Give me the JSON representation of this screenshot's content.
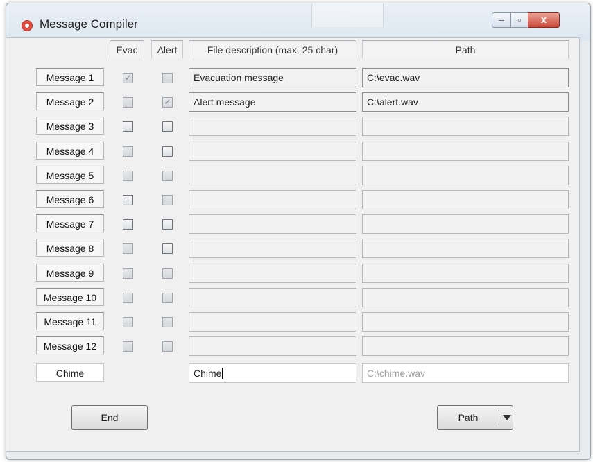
{
  "window": {
    "title": "Message Compiler",
    "controls": {
      "minimize": "–",
      "maximize": "▫",
      "close": "x"
    }
  },
  "headers": {
    "evac": "Evac",
    "alert": "Alert",
    "description": "File description (max. 25 char)",
    "path": "Path"
  },
  "rows": [
    {
      "label": "Message 1",
      "evac": true,
      "alert": false,
      "description": "Evacuation message",
      "path": "C:\\evac.wav"
    },
    {
      "label": "Message 2",
      "evac": false,
      "alert": true,
      "description": "Alert message",
      "path": "C:\\alert.wav"
    },
    {
      "label": "Message 3",
      "evac": false,
      "alert": false,
      "description": "",
      "path": ""
    },
    {
      "label": "Message 4",
      "evac": false,
      "alert": false,
      "description": "",
      "path": ""
    },
    {
      "label": "Message 5",
      "evac": false,
      "alert": false,
      "description": "",
      "path": ""
    },
    {
      "label": "Message 6",
      "evac": false,
      "alert": false,
      "description": "",
      "path": ""
    },
    {
      "label": "Message 7",
      "evac": false,
      "alert": false,
      "description": "",
      "path": ""
    },
    {
      "label": "Message 8",
      "evac": false,
      "alert": false,
      "description": "",
      "path": ""
    },
    {
      "label": "Message 9",
      "evac": false,
      "alert": false,
      "description": "",
      "path": ""
    },
    {
      "label": "Message 10",
      "evac": false,
      "alert": false,
      "description": "",
      "path": ""
    },
    {
      "label": "Message 11",
      "evac": false,
      "alert": false,
      "description": "",
      "path": ""
    },
    {
      "label": "Message 12",
      "evac": false,
      "alert": false,
      "description": "",
      "path": ""
    }
  ],
  "chime": {
    "label": "Chime",
    "description": "Chime",
    "path_placeholder": "C:\\chime.wav"
  },
  "buttons": {
    "end": "End",
    "path": "Path"
  }
}
